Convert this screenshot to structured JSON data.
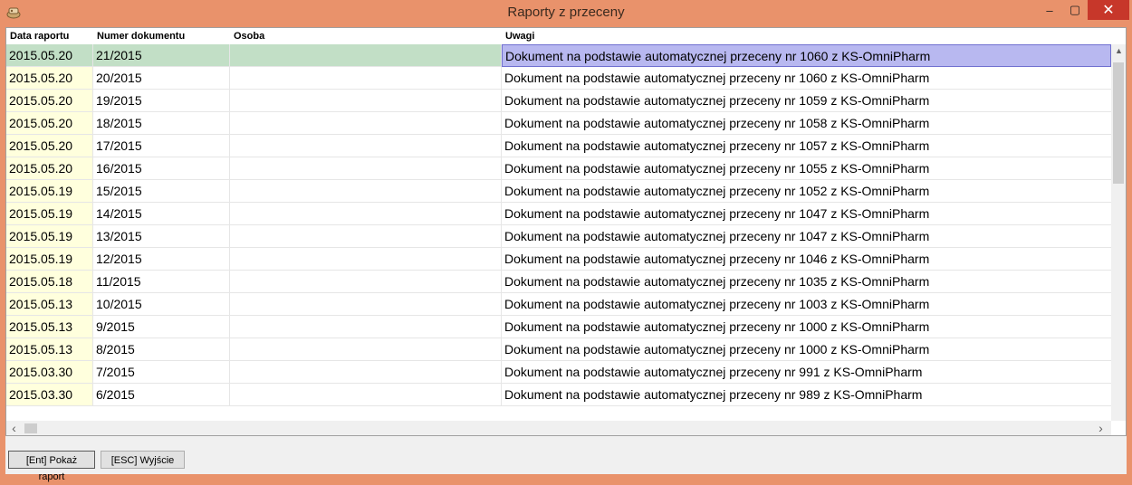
{
  "window": {
    "title": "Raporty z przeceny",
    "icon": "app-icon",
    "controls": {
      "minimize": "–",
      "maximize": "▢",
      "close": "✕"
    }
  },
  "table": {
    "columns": [
      "Data raportu",
      "Numer dokumentu",
      "Osoba",
      "Uwagi"
    ],
    "rows": [
      {
        "date": "2015.05.20",
        "number": "21/2015",
        "osoba": "",
        "uwagi": "Dokument na podstawie automatycznej przeceny nr 1060 z KS-OmniPharm"
      },
      {
        "date": "2015.05.20",
        "number": "20/2015",
        "osoba": "",
        "uwagi": "Dokument na podstawie automatycznej przeceny nr 1060 z KS-OmniPharm"
      },
      {
        "date": "2015.05.20",
        "number": "19/2015",
        "osoba": "",
        "uwagi": "Dokument na podstawie automatycznej przeceny nr 1059 z KS-OmniPharm"
      },
      {
        "date": "2015.05.20",
        "number": "18/2015",
        "osoba": "",
        "uwagi": "Dokument na podstawie automatycznej przeceny nr 1058 z KS-OmniPharm"
      },
      {
        "date": "2015.05.20",
        "number": "17/2015",
        "osoba": "",
        "uwagi": "Dokument na podstawie automatycznej przeceny nr 1057 z KS-OmniPharm"
      },
      {
        "date": "2015.05.20",
        "number": "16/2015",
        "osoba": "",
        "uwagi": "Dokument na podstawie automatycznej przeceny nr 1055 z KS-OmniPharm"
      },
      {
        "date": "2015.05.19",
        "number": "15/2015",
        "osoba": "",
        "uwagi": "Dokument na podstawie automatycznej przeceny nr 1052 z KS-OmniPharm"
      },
      {
        "date": "2015.05.19",
        "number": "14/2015",
        "osoba": "",
        "uwagi": "Dokument na podstawie automatycznej przeceny nr 1047 z KS-OmniPharm"
      },
      {
        "date": "2015.05.19",
        "number": "13/2015",
        "osoba": "",
        "uwagi": "Dokument na podstawie automatycznej przeceny nr 1047 z KS-OmniPharm"
      },
      {
        "date": "2015.05.19",
        "number": "12/2015",
        "osoba": "",
        "uwagi": "Dokument na podstawie automatycznej przeceny nr 1046 z KS-OmniPharm"
      },
      {
        "date": "2015.05.18",
        "number": "11/2015",
        "osoba": "",
        "uwagi": "Dokument na podstawie automatycznej przeceny nr 1035 z KS-OmniPharm"
      },
      {
        "date": "2015.05.13",
        "number": "10/2015",
        "osoba": "",
        "uwagi": "Dokument na podstawie automatycznej przeceny nr 1003 z KS-OmniPharm"
      },
      {
        "date": "2015.05.13",
        "number": "9/2015",
        "osoba": "",
        "uwagi": "Dokument na podstawie automatycznej przeceny nr 1000 z KS-OmniPharm"
      },
      {
        "date": "2015.05.13",
        "number": "8/2015",
        "osoba": "",
        "uwagi": "Dokument na podstawie automatycznej przeceny nr 1000 z KS-OmniPharm"
      },
      {
        "date": "2015.03.30",
        "number": "7/2015",
        "osoba": "",
        "uwagi": "Dokument na podstawie automatycznej przeceny nr 991 z KS-OmniPharm"
      },
      {
        "date": "2015.03.30",
        "number": "6/2015",
        "osoba": "",
        "uwagi": "Dokument na podstawie automatycznej przeceny nr 989 z KS-OmniPharm"
      }
    ],
    "selected_row": 0
  },
  "scrollbars": {
    "left_arrow": "‹",
    "right_arrow": "›",
    "up_arrow": "▲"
  },
  "footer": {
    "show_report": "[Ent] Pokaż raport",
    "exit": "[ESC] Wyjście"
  },
  "colors": {
    "titlebar": "#E9926B",
    "close": "#C7372A",
    "date_column": "#FFFFDD",
    "selected_row": "#C2DFC6",
    "selected_cell": "#B8B8F0"
  }
}
